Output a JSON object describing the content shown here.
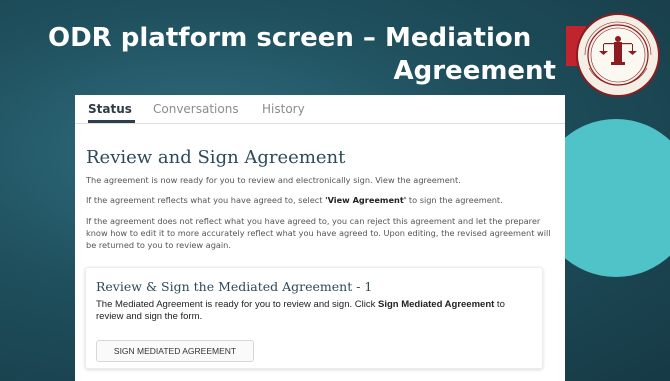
{
  "slide": {
    "title_line1": "ODR platform screen – Mediation",
    "title_line2": "Agreement",
    "seal_icon": "tennessee-judiciary-seal-icon"
  },
  "tabs": [
    {
      "label": "Status",
      "active": true
    },
    {
      "label": "Conversations",
      "active": false
    },
    {
      "label": "History",
      "active": false
    }
  ],
  "review": {
    "heading": "Review and Sign Agreement",
    "p1": "The agreement is now ready for you to review and electronically sign. View the agreement.",
    "p2_before": "If the agreement reflects what you have agreed to, select ",
    "p2_bold": "'View Agreement'",
    "p2_after": " to sign the agreement.",
    "p3": "If the agreement does not reflect what you have agreed to, you can reject this agreement and let the preparer know how to edit it to more accurately reflect what you have agreed to. Upon editing, the revised agreement will be returned to you to review again."
  },
  "card": {
    "title": "Review & Sign the Mediated Agreement - 1",
    "text_before": "The Mediated Agreement is ready for you to review and sign. Click ",
    "text_bold": "Sign Mediated Agreement",
    "text_after": " to review and sign the form.",
    "button_label": "SIGN MEDIATED AGREEMENT"
  },
  "colors": {
    "background": "#1f4f5d",
    "accent_circle": "#4fc3c7",
    "heading": "#2d4a5a",
    "seal_red": "#c0252d"
  }
}
